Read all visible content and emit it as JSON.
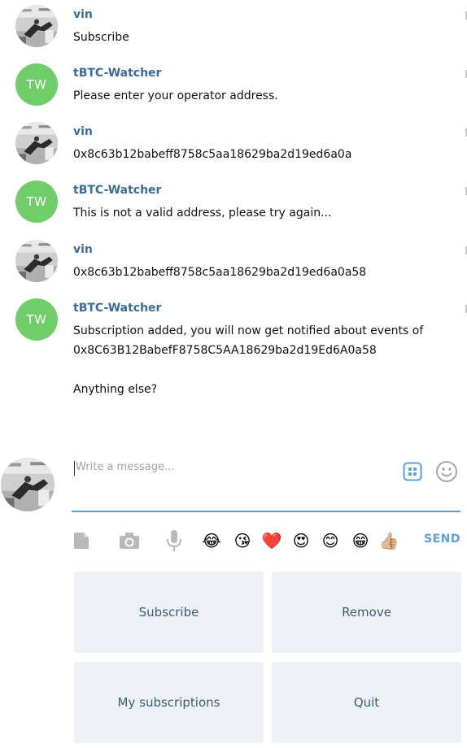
{
  "messages": [
    {
      "sender": "vin",
      "avatar": "photo",
      "lines": [
        "Subscribe"
      ]
    },
    {
      "sender": "tBTC-Watcher",
      "avatar": "TW",
      "lines": [
        "Please enter your operator address."
      ]
    },
    {
      "sender": "vin",
      "avatar": "photo",
      "lines": [
        "0x8c63b12babeff8758c5aa18629ba2d19ed6a0a"
      ]
    },
    {
      "sender": "tBTC-Watcher",
      "avatar": "TW",
      "lines": [
        "This is not a valid address, please try again..."
      ]
    },
    {
      "sender": "vin",
      "avatar": "photo",
      "lines": [
        "0x8c63b12babeff8758c5aa18629ba2d19ed6a0a58"
      ]
    },
    {
      "sender": "tBTC-Watcher",
      "avatar": "TW",
      "lines": [
        "Subscription added, you will now get notified about events of",
        "0x8C63B12BabefF8758C5AA18629ba2d19Ed6A0a58",
        "",
        "Anything else?"
      ]
    }
  ],
  "composer": {
    "placeholder": "Write a message...",
    "send_label": "SEND",
    "attach_icons": [
      "document-icon",
      "camera-icon",
      "microphone-icon"
    ],
    "emojis": [
      "😂",
      "😘",
      "❤️",
      "😍",
      "😊",
      "😁",
      "👍🏼"
    ]
  },
  "keyboard": [
    {
      "label": "Subscribe"
    },
    {
      "label": "Remove"
    },
    {
      "label": "My subscriptions"
    },
    {
      "label": "Quit"
    }
  ],
  "colors": {
    "sender_name": "#3a6d99",
    "tw_avatar": "#6fcd6a",
    "accent": "#5aa0d6",
    "keyboard_bg": "#eef2f6",
    "keyboard_text": "#3e5b7a"
  }
}
